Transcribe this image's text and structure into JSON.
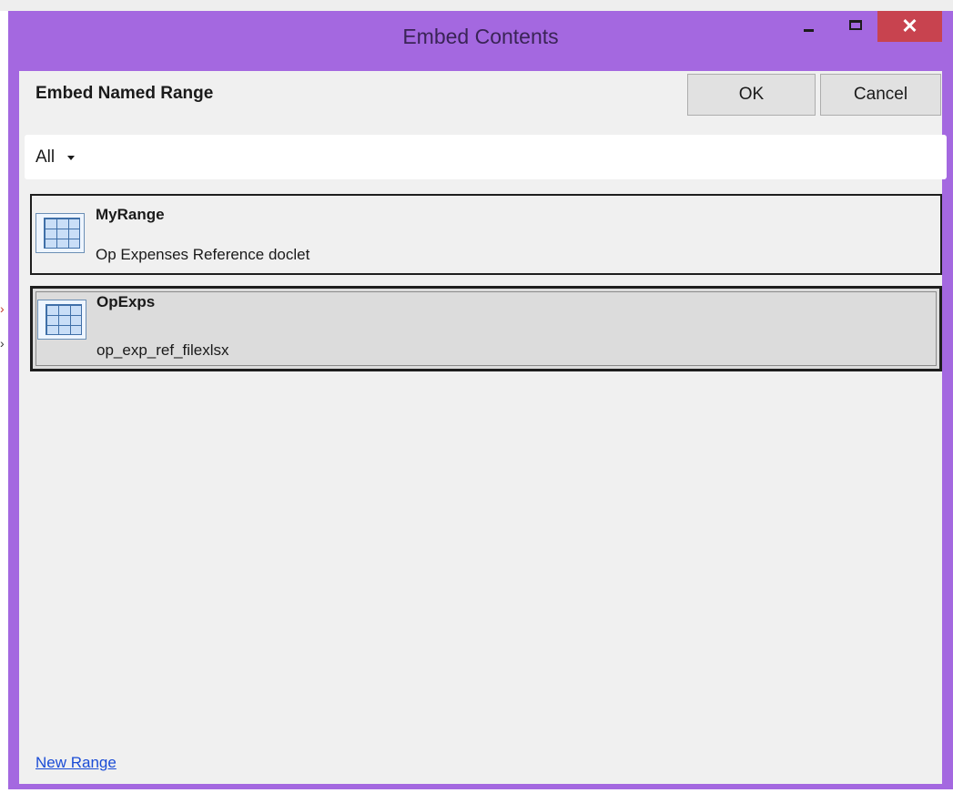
{
  "window": {
    "title": "Embed Contents",
    "accent_color": "#a468e0",
    "close_color": "#c8434f",
    "controls": {
      "minimize": "minimize-icon",
      "maximize": "maximize-icon",
      "close_glyph": "✕"
    }
  },
  "header": {
    "heading": "Embed Named Range",
    "ok_label": "OK",
    "cancel_label": "Cancel"
  },
  "filter": {
    "value": "All",
    "icon": "chevron-down-icon"
  },
  "ranges": [
    {
      "name": "MyRange",
      "description": "Op Expenses Reference doclet",
      "icon": "table-grid-icon",
      "selected": false
    },
    {
      "name": "OpExps",
      "description": "op_exp_ref_filexlsx",
      "icon": "table-grid-icon",
      "selected": true
    }
  ],
  "footer": {
    "new_range_label": "New Range",
    "link_color": "#1a4cd6"
  }
}
